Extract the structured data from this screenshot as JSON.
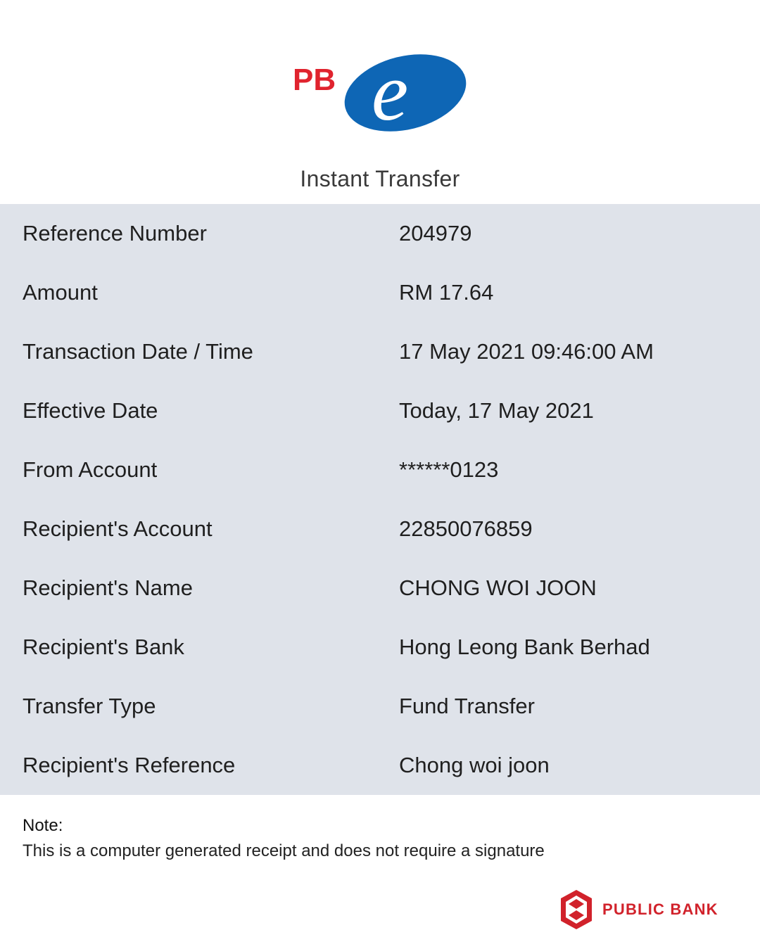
{
  "header": {
    "logo": {
      "left_text": "PB",
      "right_text": "e",
      "colors": {
        "red": "#e0232e",
        "blue": "#0e66b5"
      }
    },
    "title": "Instant Transfer"
  },
  "details": [
    {
      "label": "Reference Number",
      "value": "204979"
    },
    {
      "label": "Amount",
      "value": "RM 17.64"
    },
    {
      "label": "Transaction Date / Time",
      "value": "17 May 2021 09:46:00 AM"
    },
    {
      "label": "Effective Date",
      "value": "Today, 17 May 2021"
    },
    {
      "label": "From Account",
      "value": "******0123"
    },
    {
      "label": "Recipient's Account",
      "value": "22850076859"
    },
    {
      "label": "Recipient's Name",
      "value": "CHONG WOI JOON"
    },
    {
      "label": "Recipient's Bank",
      "value": "Hong Leong Bank Berhad"
    },
    {
      "label": "Transfer Type",
      "value": "Fund Transfer"
    },
    {
      "label": "Recipient's Reference",
      "value": "Chong woi joon"
    }
  ],
  "note": {
    "heading": "Note:",
    "text": "This is a computer generated receipt and does not require a signature"
  },
  "footer": {
    "brand_name": "PUBLIC BANK",
    "brand_color": "#d1222b"
  },
  "colors": {
    "details_background": "#dfe3ea"
  }
}
